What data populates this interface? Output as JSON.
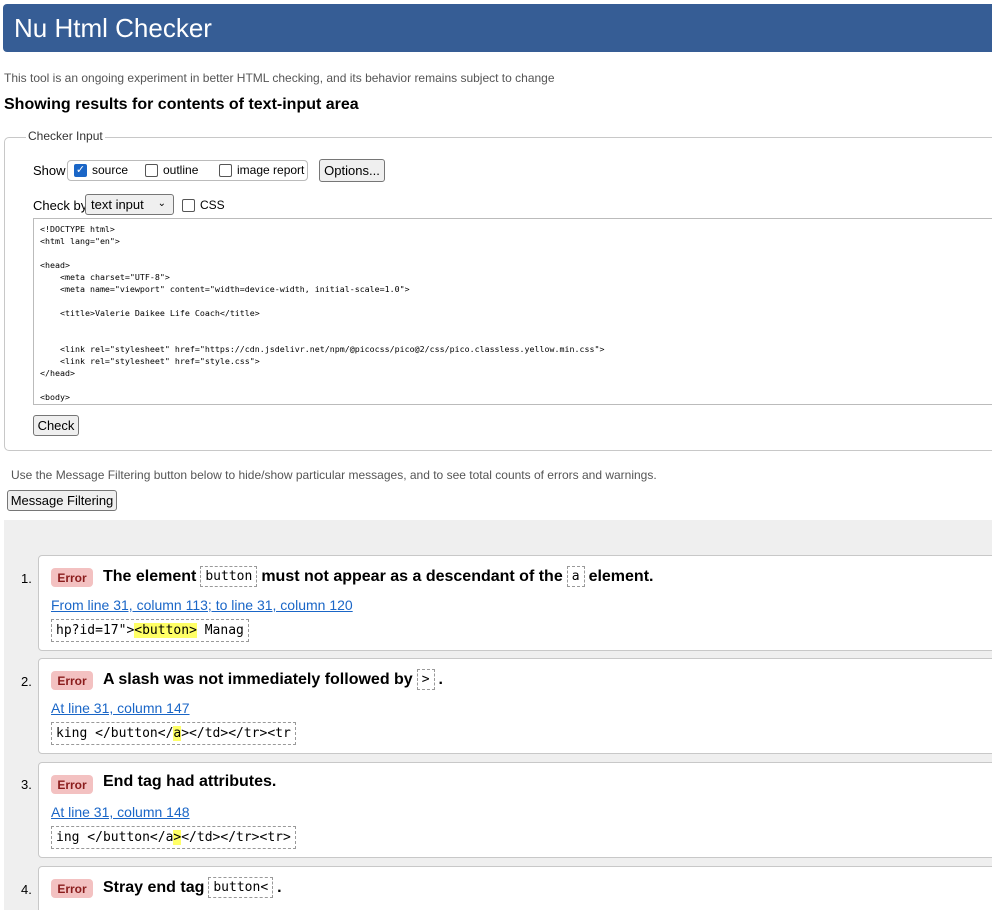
{
  "header": {
    "title": "Nu Html Checker"
  },
  "intro": {
    "subtitle": "This tool is an ongoing experiment in better HTML checking, and its behavior remains subject to change",
    "showing": "Showing results for contents of text-input area"
  },
  "checker_input": {
    "legend": "Checker Input",
    "show_label": "Show",
    "options": [
      {
        "label": "source",
        "checked": true
      },
      {
        "label": "outline",
        "checked": false
      },
      {
        "label": "image report",
        "checked": false
      }
    ],
    "options_button": "Options...",
    "check_by_label": "Check by",
    "check_by_value": "text input",
    "css_label": "CSS",
    "source_text": "<!DOCTYPE html>\n<html lang=\"en\">\n\n<head>\n    <meta charset=\"UTF-8\">\n    <meta name=\"viewport\" content=\"width=device-width, initial-scale=1.0\">\n\n    <title>Valerie Daikee Life Coach</title>\n\n\n    <link rel=\"stylesheet\" href=\"https://cdn.jsdelivr.net/npm/@picocss/pico@2/css/pico.classless.yellow.min.css\">\n    <link rel=\"stylesheet\" href=\"style.css\">\n</head>\n\n<body>",
    "check_button": "Check"
  },
  "filter": {
    "hint": "Use the Message Filtering button below to hide/show particular messages, and to see total counts of errors and warnings.",
    "button": "Message Filtering"
  },
  "messages": [
    {
      "number": "1.",
      "badge": "Error",
      "text_before": "The element",
      "code": "button",
      "text_after": "must not appear as a descendant of the",
      "code2": "a",
      "text_end": "element.",
      "location": "From line 31, column 113; to line 31, column 120",
      "extract_pre": "hp?id=17\">",
      "extract_hl": "<button>",
      "extract_post": " Manag"
    },
    {
      "number": "2.",
      "badge": "Error",
      "text_before": "A slash was not immediately followed by",
      "code": ">",
      "text_after": ".",
      "location": "At line 31, column 147",
      "extract_pre": "king </button</",
      "extract_hl": "a",
      "extract_post": "></td></tr><tr"
    },
    {
      "number": "3.",
      "badge": "Error",
      "text_before": "End tag had attributes.",
      "location": "At line 31, column 148",
      "extract_pre": "ing </button</a",
      "extract_hl": ">",
      "extract_post": "</td></tr><tr>"
    },
    {
      "number": "4.",
      "badge": "Error",
      "text_before": "Stray end tag",
      "code": "button<",
      "text_after": "."
    }
  ]
}
